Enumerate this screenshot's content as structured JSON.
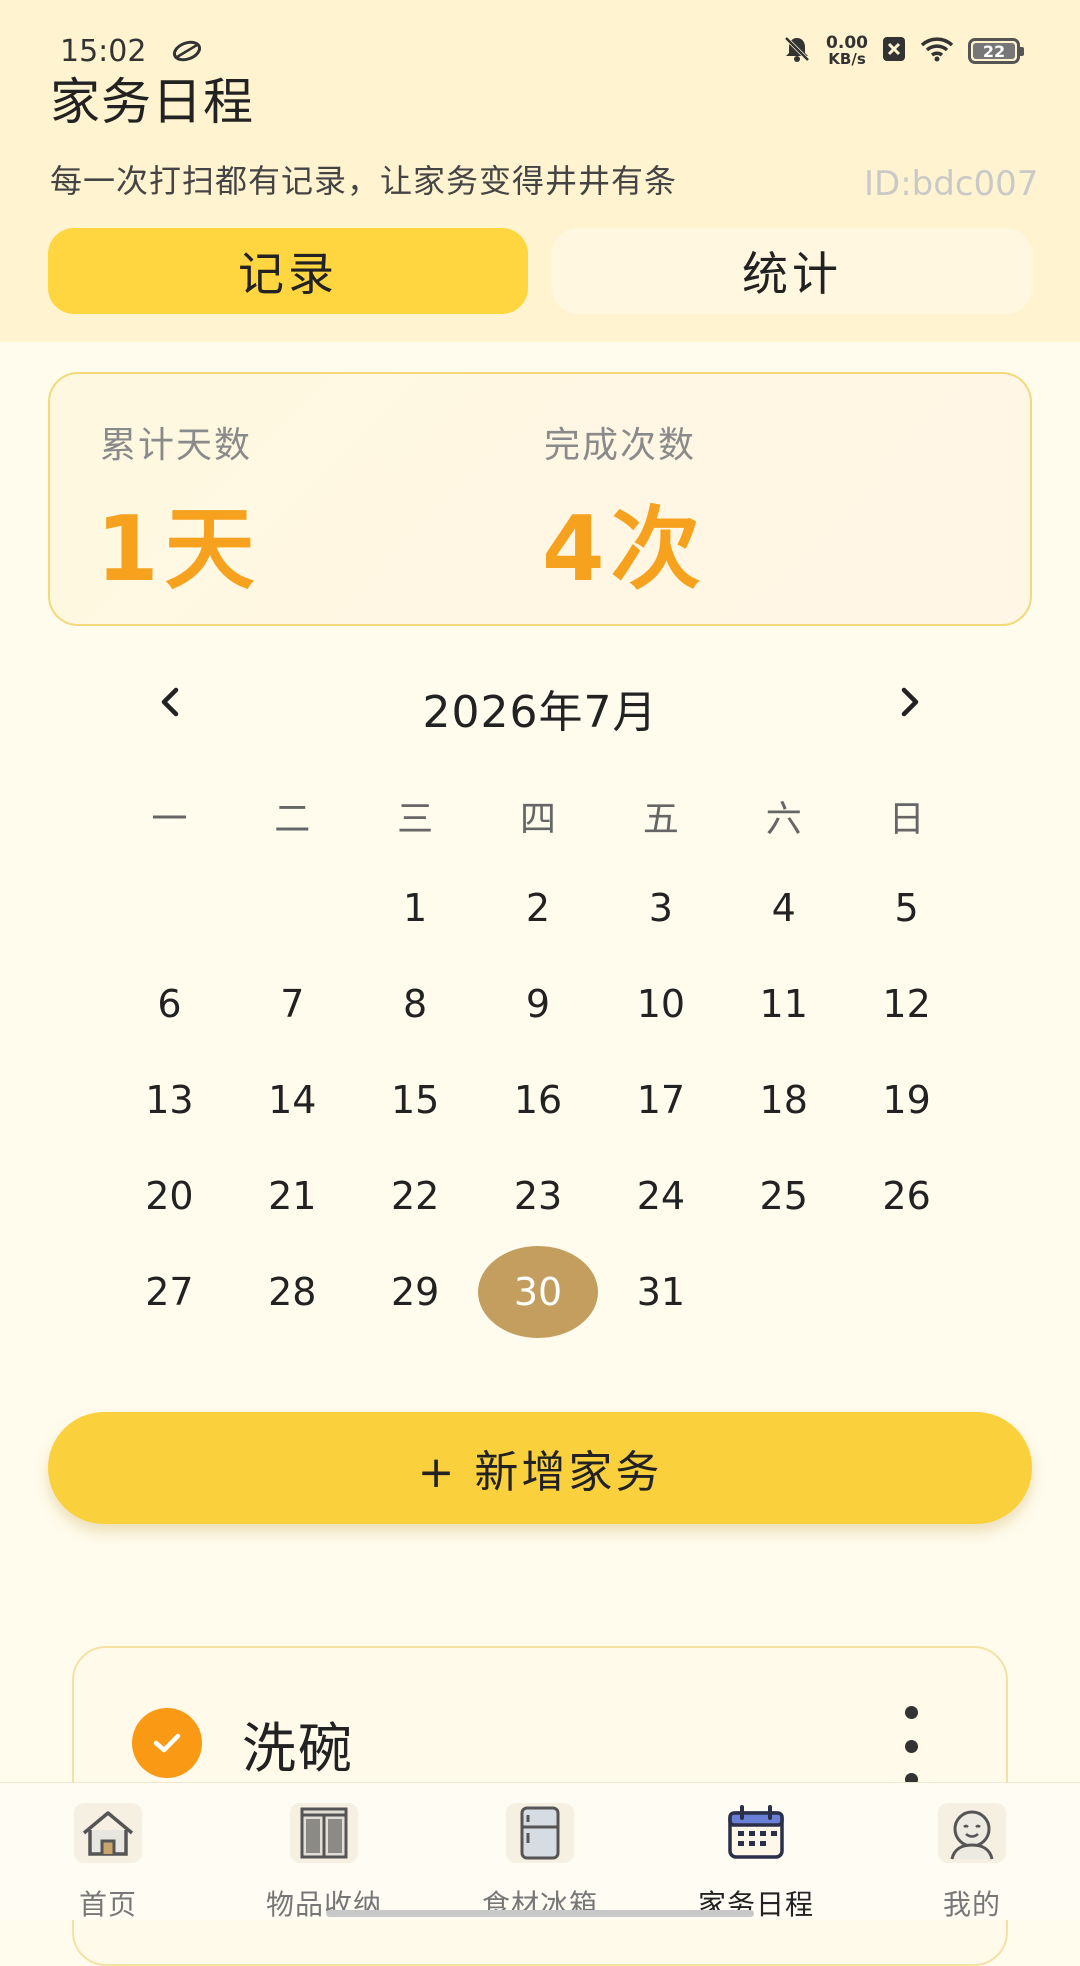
{
  "status_bar": {
    "time": "15:02",
    "net_speed_value": "0.00",
    "net_speed_unit": "KB/s",
    "battery": "22"
  },
  "header": {
    "title": "家务日程",
    "subtitle": "每一次打扫都有记录，让家务变得井井有条",
    "watermark": "ID:bdc007"
  },
  "tabs": [
    {
      "label": "记录",
      "active": true
    },
    {
      "label": "统计",
      "active": false
    }
  ],
  "stats": {
    "total_days_label": "累计天数",
    "total_days_value": "1天",
    "completed_label": "完成次数",
    "completed_value": "4次"
  },
  "calendar": {
    "prev": "‹",
    "next": "›",
    "title": "2026年7月",
    "weekdays": [
      "一",
      "二",
      "三",
      "四",
      "五",
      "六",
      "日"
    ],
    "weeks": [
      [
        "",
        "",
        "1",
        "2",
        "3",
        "4",
        "5"
      ],
      [
        "6",
        "7",
        "8",
        "9",
        "10",
        "11",
        "12"
      ],
      [
        "13",
        "14",
        "15",
        "16",
        "17",
        "18",
        "19"
      ],
      [
        "20",
        "21",
        "22",
        "23",
        "24",
        "25",
        "26"
      ],
      [
        "27",
        "28",
        "29",
        "30",
        "31",
        "",
        ""
      ]
    ],
    "selected_day": "30"
  },
  "add_button": {
    "label": "+ 新增家务"
  },
  "task": {
    "title": "洗碗",
    "done": true
  },
  "bottom_nav": [
    {
      "label": "首页",
      "icon": "house-icon",
      "active": false
    },
    {
      "label": "物品收纳",
      "icon": "cabinet-icon",
      "active": false
    },
    {
      "label": "食材冰箱",
      "icon": "fridge-icon",
      "active": false
    },
    {
      "label": "家务日程",
      "icon": "calendar-icon",
      "active": true
    },
    {
      "label": "我的",
      "icon": "profile-face-icon",
      "active": false
    }
  ],
  "colors": {
    "accent": "#FFD640",
    "stat_value": "#F6A21E",
    "selected_day": "#C39E5F",
    "task_check": "#FA9A14"
  }
}
